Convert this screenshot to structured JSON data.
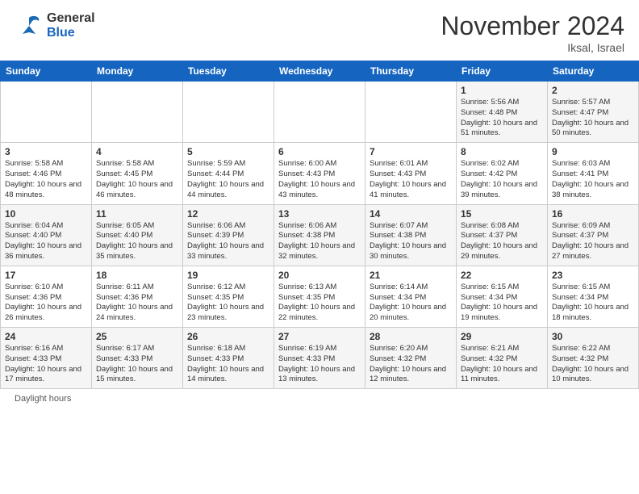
{
  "logo": {
    "general": "General",
    "blue": "Blue"
  },
  "header": {
    "title": "November 2024",
    "location": "Iksal, Israel"
  },
  "weekdays": [
    "Sunday",
    "Monday",
    "Tuesday",
    "Wednesday",
    "Thursday",
    "Friday",
    "Saturday"
  ],
  "footer": {
    "daylight_label": "Daylight hours"
  },
  "weeks": [
    [
      {
        "day": "",
        "info": ""
      },
      {
        "day": "",
        "info": ""
      },
      {
        "day": "",
        "info": ""
      },
      {
        "day": "",
        "info": ""
      },
      {
        "day": "",
        "info": ""
      },
      {
        "day": "1",
        "info": "Sunrise: 5:56 AM\nSunset: 4:48 PM\nDaylight: 10 hours\nand 51 minutes."
      },
      {
        "day": "2",
        "info": "Sunrise: 5:57 AM\nSunset: 4:47 PM\nDaylight: 10 hours\nand 50 minutes."
      }
    ],
    [
      {
        "day": "3",
        "info": "Sunrise: 5:58 AM\nSunset: 4:46 PM\nDaylight: 10 hours\nand 48 minutes."
      },
      {
        "day": "4",
        "info": "Sunrise: 5:58 AM\nSunset: 4:45 PM\nDaylight: 10 hours\nand 46 minutes."
      },
      {
        "day": "5",
        "info": "Sunrise: 5:59 AM\nSunset: 4:44 PM\nDaylight: 10 hours\nand 44 minutes."
      },
      {
        "day": "6",
        "info": "Sunrise: 6:00 AM\nSunset: 4:43 PM\nDaylight: 10 hours\nand 43 minutes."
      },
      {
        "day": "7",
        "info": "Sunrise: 6:01 AM\nSunset: 4:43 PM\nDaylight: 10 hours\nand 41 minutes."
      },
      {
        "day": "8",
        "info": "Sunrise: 6:02 AM\nSunset: 4:42 PM\nDaylight: 10 hours\nand 39 minutes."
      },
      {
        "day": "9",
        "info": "Sunrise: 6:03 AM\nSunset: 4:41 PM\nDaylight: 10 hours\nand 38 minutes."
      }
    ],
    [
      {
        "day": "10",
        "info": "Sunrise: 6:04 AM\nSunset: 4:40 PM\nDaylight: 10 hours\nand 36 minutes."
      },
      {
        "day": "11",
        "info": "Sunrise: 6:05 AM\nSunset: 4:40 PM\nDaylight: 10 hours\nand 35 minutes."
      },
      {
        "day": "12",
        "info": "Sunrise: 6:06 AM\nSunset: 4:39 PM\nDaylight: 10 hours\nand 33 minutes."
      },
      {
        "day": "13",
        "info": "Sunrise: 6:06 AM\nSunset: 4:38 PM\nDaylight: 10 hours\nand 32 minutes."
      },
      {
        "day": "14",
        "info": "Sunrise: 6:07 AM\nSunset: 4:38 PM\nDaylight: 10 hours\nand 30 minutes."
      },
      {
        "day": "15",
        "info": "Sunrise: 6:08 AM\nSunset: 4:37 PM\nDaylight: 10 hours\nand 29 minutes."
      },
      {
        "day": "16",
        "info": "Sunrise: 6:09 AM\nSunset: 4:37 PM\nDaylight: 10 hours\nand 27 minutes."
      }
    ],
    [
      {
        "day": "17",
        "info": "Sunrise: 6:10 AM\nSunset: 4:36 PM\nDaylight: 10 hours\nand 26 minutes."
      },
      {
        "day": "18",
        "info": "Sunrise: 6:11 AM\nSunset: 4:36 PM\nDaylight: 10 hours\nand 24 minutes."
      },
      {
        "day": "19",
        "info": "Sunrise: 6:12 AM\nSunset: 4:35 PM\nDaylight: 10 hours\nand 23 minutes."
      },
      {
        "day": "20",
        "info": "Sunrise: 6:13 AM\nSunset: 4:35 PM\nDaylight: 10 hours\nand 22 minutes."
      },
      {
        "day": "21",
        "info": "Sunrise: 6:14 AM\nSunset: 4:34 PM\nDaylight: 10 hours\nand 20 minutes."
      },
      {
        "day": "22",
        "info": "Sunrise: 6:15 AM\nSunset: 4:34 PM\nDaylight: 10 hours\nand 19 minutes."
      },
      {
        "day": "23",
        "info": "Sunrise: 6:15 AM\nSunset: 4:34 PM\nDaylight: 10 hours\nand 18 minutes."
      }
    ],
    [
      {
        "day": "24",
        "info": "Sunrise: 6:16 AM\nSunset: 4:33 PM\nDaylight: 10 hours\nand 17 minutes."
      },
      {
        "day": "25",
        "info": "Sunrise: 6:17 AM\nSunset: 4:33 PM\nDaylight: 10 hours\nand 15 minutes."
      },
      {
        "day": "26",
        "info": "Sunrise: 6:18 AM\nSunset: 4:33 PM\nDaylight: 10 hours\nand 14 minutes."
      },
      {
        "day": "27",
        "info": "Sunrise: 6:19 AM\nSunset: 4:33 PM\nDaylight: 10 hours\nand 13 minutes."
      },
      {
        "day": "28",
        "info": "Sunrise: 6:20 AM\nSunset: 4:32 PM\nDaylight: 10 hours\nand 12 minutes."
      },
      {
        "day": "29",
        "info": "Sunrise: 6:21 AM\nSunset: 4:32 PM\nDaylight: 10 hours\nand 11 minutes."
      },
      {
        "day": "30",
        "info": "Sunrise: 6:22 AM\nSunset: 4:32 PM\nDaylight: 10 hours\nand 10 minutes."
      }
    ]
  ]
}
